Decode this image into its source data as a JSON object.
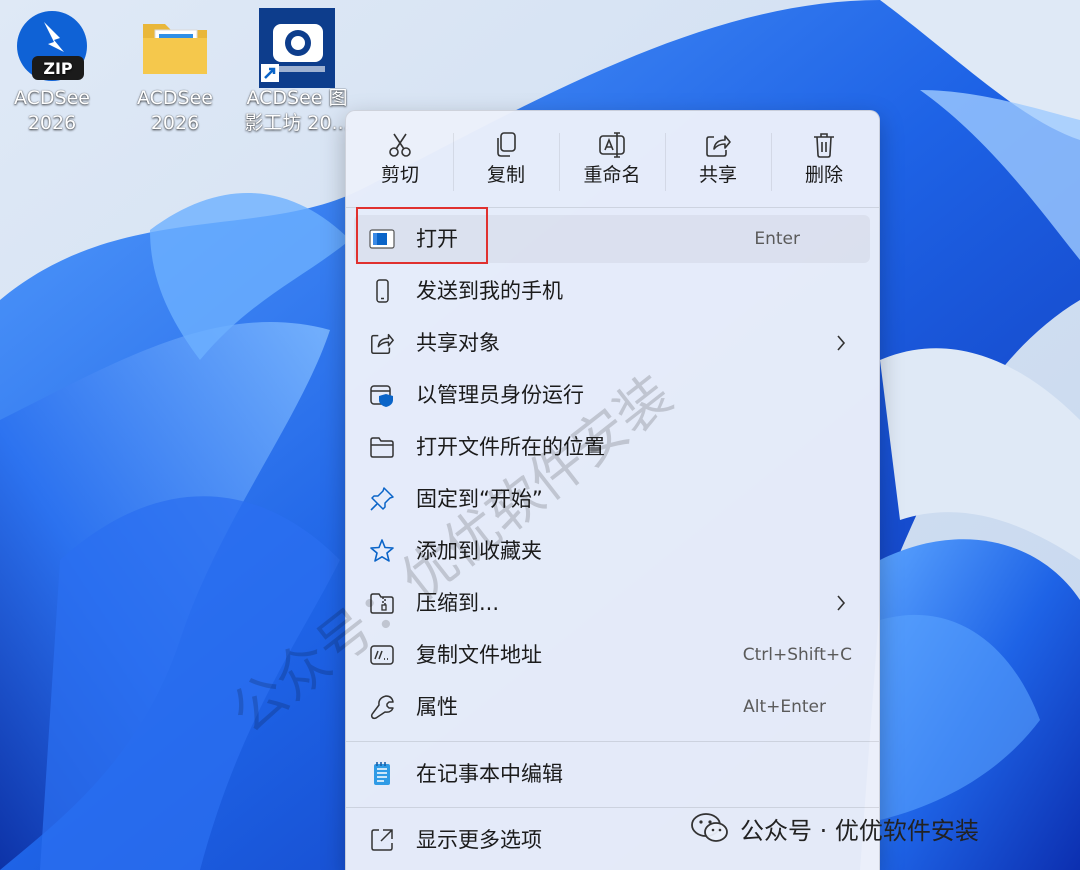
{
  "desktop": {
    "icons": [
      {
        "name_line1": "ACDSee",
        "name_line2": "2026"
      },
      {
        "name_line1": "ACDSee",
        "name_line2": "2026"
      },
      {
        "name_line1": "ACDSee 图",
        "name_line2": "影工坊 20..."
      }
    ],
    "zip_badge": "ZIP"
  },
  "context_menu": {
    "toolbar": [
      {
        "label": "剪切",
        "icon": "scissors-icon"
      },
      {
        "label": "复制",
        "icon": "copy-icon"
      },
      {
        "label": "重命名",
        "icon": "rename-icon"
      },
      {
        "label": "共享",
        "icon": "share-icon"
      },
      {
        "label": "删除",
        "icon": "trash-icon"
      }
    ],
    "items": [
      {
        "label": "打开",
        "shortcut": "Enter",
        "icon": "app-window-icon"
      },
      {
        "label": "发送到我的手机",
        "icon": "phone-icon"
      },
      {
        "label": "共享对象",
        "icon": "share-icon",
        "submenu": true
      },
      {
        "label": "以管理员身份运行",
        "icon": "shield-icon"
      },
      {
        "label": "打开文件所在的位置",
        "icon": "folder-icon"
      },
      {
        "label": "固定到“开始”",
        "icon": "pin-icon"
      },
      {
        "label": "添加到收藏夹",
        "icon": "star-icon"
      },
      {
        "label": "压缩到...",
        "icon": "zip-folder-icon",
        "submenu": true
      },
      {
        "label": "复制文件地址",
        "shortcut": "Ctrl+Shift+C",
        "icon": "path-icon"
      },
      {
        "label": "属性",
        "shortcut": "Alt+Enter",
        "icon": "wrench-icon"
      },
      {
        "label": "在记事本中编辑",
        "icon": "notepad-icon"
      },
      {
        "label": "显示更多选项",
        "icon": "expand-icon"
      }
    ]
  },
  "watermark": {
    "bottom_text": "公众号 · 优优软件安装",
    "diagonal_text": "公众号：优优软件安装"
  },
  "colors": {
    "highlight_border": "#e0312f",
    "wallpaper_blue": "#1f5fe0",
    "accent": "#0a64c8"
  }
}
